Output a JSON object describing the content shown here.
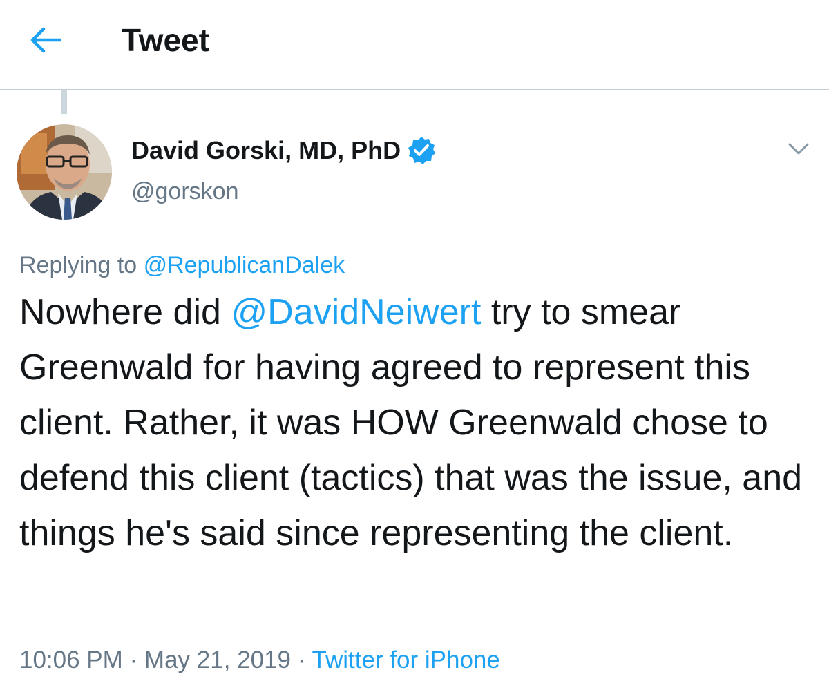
{
  "header": {
    "title": "Tweet",
    "back_icon": "arrow-left-icon"
  },
  "colors": {
    "accent": "#1da1f2",
    "text": "#14171a",
    "muted": "#657786",
    "divider": "#c7cfd6"
  },
  "author": {
    "display_name": "David Gorski, MD, PhD",
    "handle": "@gorskon",
    "verified_icon": "verified-badge-icon"
  },
  "tweet": {
    "replying_prefix": "Replying to",
    "replying_to": "@RepublicanDalek",
    "text_part1": "Nowhere did ",
    "mention": "@DavidNeiwert",
    "text_part2": " try to smear Greenwald for having agreed to represent this client. Rather, it was HOW Greenwald chose to defend this client (tactics) that was the issue, and things he's said since representing the client.",
    "time": "10:06 PM",
    "separator": " · ",
    "date": "May 21, 2019",
    "source": "Twitter for iPhone"
  }
}
